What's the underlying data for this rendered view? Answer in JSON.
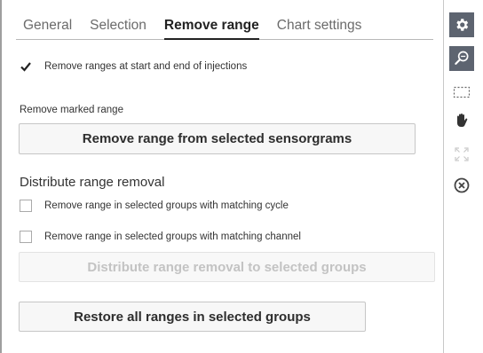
{
  "tabs": [
    {
      "label": "General",
      "active": false
    },
    {
      "label": "Selection",
      "active": false
    },
    {
      "label": "Remove range",
      "active": true
    },
    {
      "label": "Chart settings",
      "active": false
    }
  ],
  "options": {
    "remove_at_start_end": {
      "label": "Remove ranges at start and end of injections",
      "checked": true
    }
  },
  "remove_marked": {
    "label": "Remove marked range",
    "button_label": "Remove range from selected sensorgrams"
  },
  "distribute": {
    "heading": "Distribute range removal",
    "matching_cycle": {
      "label": "Remove range in selected groups with matching cycle",
      "checked": false
    },
    "matching_channel": {
      "label": "Remove range in selected groups with matching channel",
      "checked": false
    },
    "button_label": "Distribute range removal to selected groups",
    "button_enabled": false
  },
  "restore": {
    "button_label": "Restore all ranges in selected groups"
  },
  "toolbar": {
    "icons": [
      "settings-gear-icon",
      "zoom-search-icon",
      "marquee-select-icon",
      "pan-hand-icon",
      "fit-expand-icon",
      "close-circle-icon"
    ]
  },
  "colors": {
    "toolbar_active_bg": "#5d6470",
    "accent_text": "#222222",
    "disabled_text": "#c3c3c3"
  }
}
